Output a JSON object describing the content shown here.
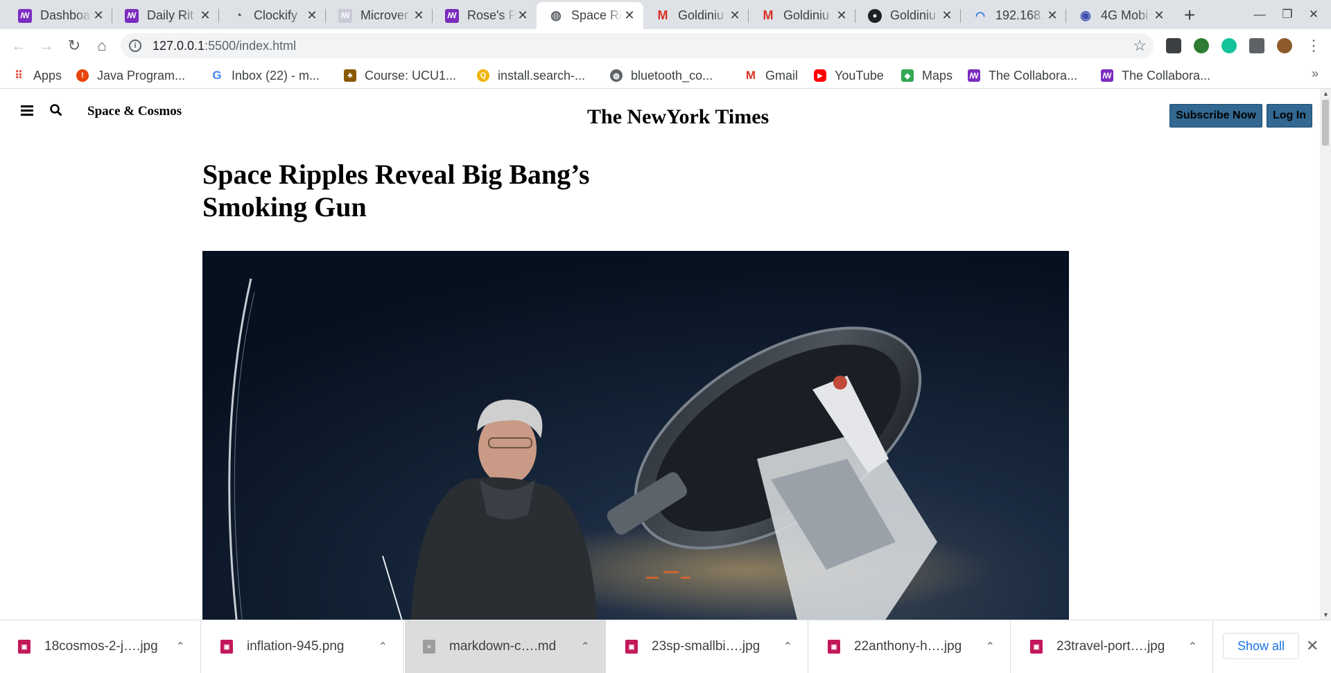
{
  "tabs": [
    {
      "title": "Dashboard",
      "icon": "collab-icon",
      "color": "#7b2cbf"
    },
    {
      "title": "Daily Rit",
      "icon": "collab-icon",
      "color": "#7b2cbf"
    },
    {
      "title": "Clockify",
      "icon": "clockify-icon",
      "color": "#5f6368"
    },
    {
      "title": "Microver",
      "icon": "collab-icon",
      "color": "#c9c9d8"
    },
    {
      "title": "Rose's P",
      "icon": "collab-icon",
      "color": "#7b2cbf"
    },
    {
      "title": "Space Ri",
      "icon": "globe-icon",
      "color": "#5f6368"
    },
    {
      "title": "Goldiniu",
      "icon": "gmail-icon",
      "color": "#d93025"
    },
    {
      "title": "Goldiniu",
      "icon": "gmail-icon",
      "color": "#d93025"
    },
    {
      "title": "Goldiniu",
      "icon": "github-icon",
      "color": "#202124"
    },
    {
      "title": "192.168.",
      "icon": "wifi-icon",
      "color": "#1a73e8"
    },
    {
      "title": "4G Mobi",
      "icon": "router-icon",
      "color": "#3c4fae"
    }
  ],
  "address": {
    "host": "127.0.0.1",
    "rest": ":5500/index.html"
  },
  "bookmarks": [
    {
      "label": "Apps",
      "icon": "apps-grid-icon",
      "color": "#ea4335"
    },
    {
      "label": "Java Program...",
      "icon": "java-icon",
      "color": "#e8430c"
    },
    {
      "label": "Inbox (22) - m...",
      "icon": "google-icon",
      "color": "#4285f4"
    },
    {
      "label": "Course: UCU1...",
      "icon": "course-icon",
      "color": "#8b5a00"
    },
    {
      "label": "install.search-...",
      "icon": "search-q-icon",
      "color": "#f0b400"
    },
    {
      "label": "bluetooth_co...",
      "icon": "globe-icon",
      "color": "#5f6368"
    },
    {
      "label": "Gmail",
      "icon": "gmail-icon",
      "color": "#d93025"
    },
    {
      "label": "YouTube",
      "icon": "youtube-icon",
      "color": "#ff0000"
    },
    {
      "label": "Maps",
      "icon": "maps-icon",
      "color": "#34a853"
    },
    {
      "label": "The Collabora...",
      "icon": "collab-icon",
      "color": "#7b2cbf"
    },
    {
      "label": "The Collabora...",
      "icon": "collab-icon",
      "color": "#7b2cbf"
    }
  ],
  "page": {
    "section": "Space & Cosmos",
    "masthead": "The NewYork Times",
    "subscribe": "Subscribe Now",
    "login": "Log In",
    "headline_line1": "Space Ripples Reveal Big Bang’s",
    "headline_line2": "Smoking Gun"
  },
  "downloads": [
    {
      "name": "18cosmos-2-j….jpg",
      "icon": "image-file-icon",
      "color": "#c2185b"
    },
    {
      "name": "inflation-945.png",
      "icon": "image-file-icon",
      "color": "#c2185b"
    },
    {
      "name": "markdown-c….md",
      "icon": "text-file-icon",
      "color": "#9e9e9e"
    },
    {
      "name": "23sp-smallbi….jpg",
      "icon": "image-file-icon",
      "color": "#c2185b"
    },
    {
      "name": "22anthony-h….jpg",
      "icon": "image-file-icon",
      "color": "#c2185b"
    },
    {
      "name": "23travel-port….jpg",
      "icon": "image-file-icon",
      "color": "#c2185b"
    }
  ],
  "shelf": {
    "show_all": "Show all"
  }
}
